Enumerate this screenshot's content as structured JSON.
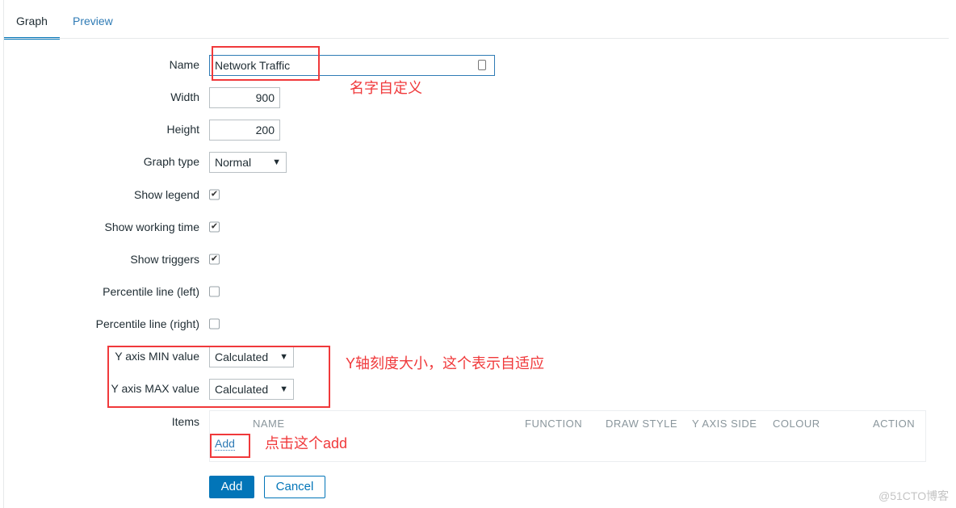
{
  "tabs": [
    {
      "label": "Graph",
      "active": true
    },
    {
      "label": "Preview",
      "active": false
    }
  ],
  "form": {
    "name": {
      "label": "Name",
      "value": "Network Traffic"
    },
    "width": {
      "label": "Width",
      "value": "900"
    },
    "height": {
      "label": "Height",
      "value": "200"
    },
    "graph_type": {
      "label": "Graph type",
      "value": "Normal"
    },
    "show_legend": {
      "label": "Show legend",
      "checked": true
    },
    "show_working_time": {
      "label": "Show working time",
      "checked": true
    },
    "show_triggers": {
      "label": "Show triggers",
      "checked": true
    },
    "percentile_left": {
      "label": "Percentile line (left)",
      "checked": false
    },
    "percentile_right": {
      "label": "Percentile line (right)",
      "checked": false
    },
    "y_min": {
      "label": "Y axis MIN value",
      "value": "Calculated"
    },
    "y_max": {
      "label": "Y axis MAX value",
      "value": "Calculated"
    },
    "items": {
      "label": "Items",
      "columns": [
        "NAME",
        "FUNCTION",
        "DRAW STYLE",
        "Y AXIS SIDE",
        "COLOUR",
        "ACTION"
      ],
      "add_link": "Add"
    }
  },
  "buttons": {
    "add": "Add",
    "cancel": "Cancel"
  },
  "annotations": {
    "name_note": "名字自定义",
    "yaxis_note": "Y轴刻度大小，这个表示自适应",
    "add_note": "点击这个add"
  },
  "watermark": "@51CTO博客",
  "colors": {
    "accent": "#0275b8",
    "annotation": "#f0393b"
  }
}
